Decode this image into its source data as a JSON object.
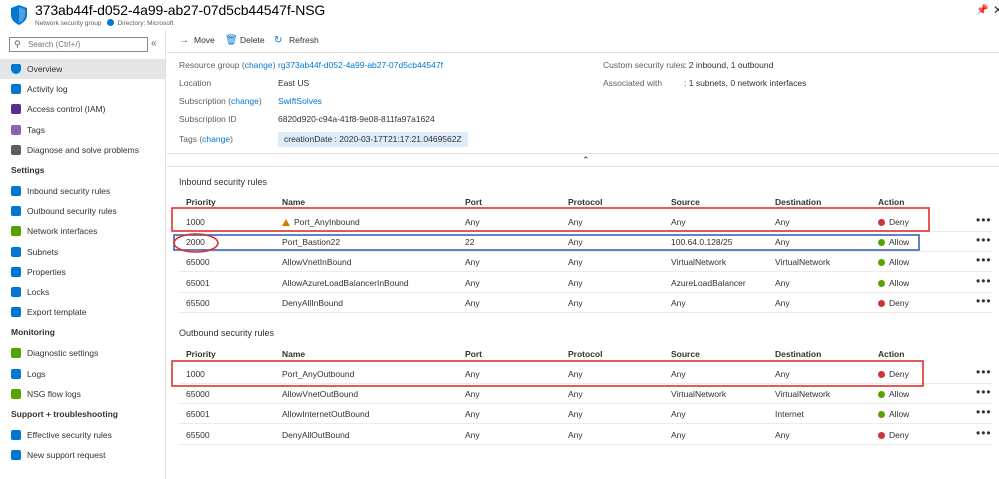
{
  "header": {
    "title": "373ab44f-d052-4a99-ab27-07d5cb44547f-NSG",
    "subtitle": "Network security group",
    "directory": "Directory: Microsoft"
  },
  "sidebar": {
    "search_placeholder": "Search (Ctrl+/)",
    "items_top": [
      {
        "label": "Overview",
        "icon": "shield-icon",
        "selected": true
      },
      {
        "label": "Activity log",
        "icon": "activity-log-icon"
      },
      {
        "label": "Access control (IAM)",
        "icon": "iam-icon"
      },
      {
        "label": "Tags",
        "icon": "tag-icon"
      },
      {
        "label": "Diagnose and solve problems",
        "icon": "wrench-icon"
      }
    ],
    "sections": [
      {
        "title": "Settings",
        "items": [
          {
            "label": "Inbound security rules",
            "icon": "inbound-rules-icon"
          },
          {
            "label": "Outbound security rules",
            "icon": "outbound-rules-icon"
          },
          {
            "label": "Network interfaces",
            "icon": "network-interface-icon"
          },
          {
            "label": "Subnets",
            "icon": "subnet-icon"
          },
          {
            "label": "Properties",
            "icon": "properties-icon"
          },
          {
            "label": "Locks",
            "icon": "lock-icon"
          },
          {
            "label": "Export template",
            "icon": "export-icon"
          }
        ]
      },
      {
        "title": "Monitoring",
        "items": [
          {
            "label": "Diagnostic settings",
            "icon": "diagnostic-icon"
          },
          {
            "label": "Logs",
            "icon": "logs-icon"
          },
          {
            "label": "NSG flow logs",
            "icon": "flow-logs-icon"
          }
        ]
      },
      {
        "title": "Support + troubleshooting",
        "items": [
          {
            "label": "Effective security rules",
            "icon": "effective-rules-icon"
          },
          {
            "label": "New support request",
            "icon": "support-icon"
          }
        ]
      }
    ]
  },
  "toolbar": {
    "move": "Move",
    "delete": "Delete",
    "refresh": "Refresh"
  },
  "essentials": {
    "resource_group_label": "Resource group",
    "change": "change",
    "resource_group": "rg373ab44f-d052-4a99-ab27-07d5cb44547f",
    "location_label": "Location",
    "location": "East US",
    "subscription_label": "Subscription",
    "subscription": "SwiftSolves",
    "subscription_id_label": "Subscription ID",
    "subscription_id": "6820d920-c94a-41f8-9e08-811fa97a1624",
    "tags_label": "Tags",
    "tag": "creationDate : 2020-03-17T21:17:21.0469562Z",
    "custom_rules_label": "Custom security rules",
    "custom_rules": "2 inbound, 1 outbound",
    "associated_label": "Associated with",
    "associated": "1 subnets, 0 network interfaces"
  },
  "columns": {
    "priority": "Priority",
    "name": "Name",
    "port": "Port",
    "protocol": "Protocol",
    "source": "Source",
    "destination": "Destination",
    "action": "Action"
  },
  "inbound": {
    "title": "Inbound security rules",
    "rules": [
      {
        "priority": "1000",
        "name": "Port_AnyInbound",
        "port": "Any",
        "protocol": "Any",
        "source": "Any",
        "destination": "Any",
        "action": "Deny",
        "warning": true
      },
      {
        "priority": "2000",
        "name": "Port_Bastion22",
        "port": "22",
        "protocol": "Any",
        "source": "100.64.0.128/25",
        "destination": "Any",
        "action": "Allow",
        "warning": false
      },
      {
        "priority": "65000",
        "name": "AllowVnetInBound",
        "port": "Any",
        "protocol": "Any",
        "source": "VirtualNetwork",
        "destination": "VirtualNetwork",
        "action": "Allow",
        "warning": false
      },
      {
        "priority": "65001",
        "name": "AllowAzureLoadBalancerInBound",
        "port": "Any",
        "protocol": "Any",
        "source": "AzureLoadBalancer",
        "destination": "Any",
        "action": "Allow",
        "warning": false
      },
      {
        "priority": "65500",
        "name": "DenyAllInBound",
        "port": "Any",
        "protocol": "Any",
        "source": "Any",
        "destination": "Any",
        "action": "Deny",
        "warning": false
      }
    ]
  },
  "outbound": {
    "title": "Outbound security rules",
    "rules": [
      {
        "priority": "1000",
        "name": "Port_AnyOutbound",
        "port": "Any",
        "protocol": "Any",
        "source": "Any",
        "destination": "Any",
        "action": "Deny",
        "warning": false
      },
      {
        "priority": "65000",
        "name": "AllowVnetOutBound",
        "port": "Any",
        "protocol": "Any",
        "source": "VirtualNetwork",
        "destination": "VirtualNetwork",
        "action": "Allow",
        "warning": false
      },
      {
        "priority": "65001",
        "name": "AllowInternetOutBound",
        "port": "Any",
        "protocol": "Any",
        "source": "Any",
        "destination": "Internet",
        "action": "Allow",
        "warning": false
      },
      {
        "priority": "65500",
        "name": "DenyAllOutBound",
        "port": "Any",
        "protocol": "Any",
        "source": "Any",
        "destination": "Any",
        "action": "Deny",
        "warning": false
      }
    ]
  },
  "colors": {
    "accent": "#0078d4",
    "deny": "#d13438",
    "allow": "#57a300",
    "annotation_red": "#e0312e",
    "annotation_blue": "#3a64b8"
  },
  "more_glyph": "•••"
}
